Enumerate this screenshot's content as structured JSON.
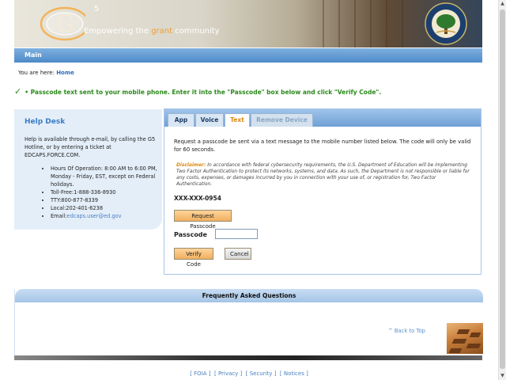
{
  "header": {
    "logo_g": "G",
    "logo_5": "5",
    "tagline_pre": "Empowering the ",
    "tagline_accent": "grant",
    "tagline_post": " community",
    "seal_text": "DEPARTMENT OF EDUCATION"
  },
  "nav": {
    "title": "Main"
  },
  "breadcrumb": {
    "prefix": "You are here: ",
    "home": "Home"
  },
  "status": {
    "check": "✓",
    "message": "• Passcode text sent to your mobile phone. Enter it into the \"Passcode\" box below and click \"Verify Code\"."
  },
  "helpdesk": {
    "title": "Help Desk",
    "intro": "Help is available through e-mail, by calling the G5 Hotline, or by entering a ticket at EDCAPS.FORCE.COM.",
    "items": [
      "Hours Of Operation: 8:00 AM to 6:00 PM, Monday - Friday, EST, except on Federal holidays.",
      "Toll-Free:1-888-336-8930",
      "TTY:800-877-8339",
      "Local:202-401-6238"
    ],
    "email_label": "Email:",
    "email": "edcaps.user@ed.gov"
  },
  "tabs": [
    "App",
    "Voice",
    "Text",
    "Remove Device"
  ],
  "text_tab": {
    "instructions": "Request a passcode be sent via a text message to the mobile number listed below. The code will only be valid for 60 seconds.",
    "disclaimer_label": "Disclaimer:",
    "disclaimer": " In accordance with federal cybersecurity requirements, the U.S. Department of Education will be implementing Two Factor Authentication to protect its networks, systems, and data. As such, the Department is not responsible or liable for any costs, expenses, or damages incurred by you in connection with your use of, or registration for, Two Factor Authentication.",
    "phone": "XXX-XXX-0954",
    "request_button": "Request Passcode",
    "passcode_label": "Passcode",
    "passcode_value": "",
    "verify_button": "Verify Code",
    "cancel_button": "Cancel"
  },
  "faq": {
    "title": "Frequently Asked Questions",
    "back_to_top": "^ Back to Top"
  },
  "footer": {
    "links": [
      "FOIA",
      "Privacy",
      "Security",
      "Notices"
    ]
  },
  "colors": {
    "accent_blue": "#4e8ac8",
    "accent_orange": "#f0b060",
    "status_green": "#2a8a1a"
  }
}
